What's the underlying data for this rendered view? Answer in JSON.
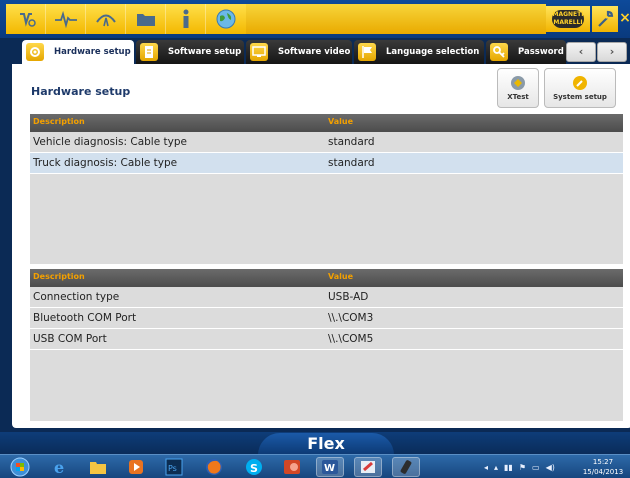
{
  "toolbar": {
    "icons": [
      "settings-gear-icon",
      "ecg-pulse-icon",
      "connection-icon",
      "folder-icon",
      "info-icon",
      "globe-icon"
    ],
    "brand_logo": "MAGNETI MARELLI",
    "minimize_label": "−",
    "close_label": "×"
  },
  "tabs": [
    {
      "label": "Hardware setup",
      "active": true
    },
    {
      "label": "Software setup",
      "active": false
    },
    {
      "label": "Software video",
      "active": false
    },
    {
      "label": "Language selection",
      "active": false
    },
    {
      "label": "Password",
      "active": false
    }
  ],
  "tab_nav": {
    "prev": "‹",
    "next": "›"
  },
  "page": {
    "title": "Hardware setup"
  },
  "actions": {
    "xtest_label": "XTest",
    "system_setup_label": "System setup"
  },
  "table1": {
    "headers": [
      "Description",
      "Value"
    ],
    "rows": [
      {
        "description": "Vehicle diagnosis: Cable type",
        "value": "standard"
      },
      {
        "description": "Truck diagnosis: Cable type",
        "value": "standard"
      }
    ]
  },
  "table2": {
    "headers": [
      "Description",
      "Value"
    ],
    "rows": [
      {
        "description": "Connection type",
        "value": "USB-AD"
      },
      {
        "description": "Bluetooth COM Port",
        "value": "\\\\.\\COM3"
      },
      {
        "description": "USB COM Port",
        "value": "\\\\.\\COM5"
      }
    ]
  },
  "app_name": "Flex",
  "taskbar": {
    "apps": [
      "start-orb",
      "internet-explorer",
      "file-explorer",
      "media-player",
      "photoshop",
      "firefox",
      "skype",
      "powerpoint",
      "word",
      "paint",
      "device-app"
    ],
    "time": "15:27",
    "date": "15/04/2013"
  },
  "colors": {
    "accent_yellow": "#f3b800",
    "header_orange": "#f3a000",
    "navy": "#0b2a55"
  }
}
